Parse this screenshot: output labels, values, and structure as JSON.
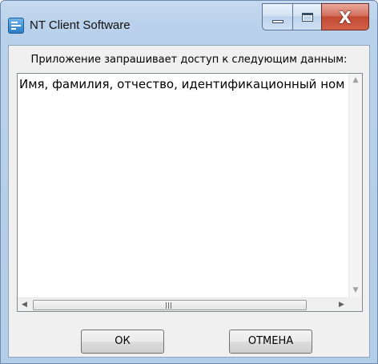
{
  "window": {
    "title": "NT Client Software",
    "caption": {
      "close_glyph": "X"
    }
  },
  "dialog": {
    "prompt": "Приложение запрашивает доступ к следующим данным:",
    "list_items": [
      "Имя, фамилия, отчество, идентификационный ном"
    ],
    "hscroll_grip": "III"
  },
  "buttons": {
    "ok_label": "ОК",
    "cancel_label": "ОТМЕНА"
  },
  "icons": {
    "app": "app-window-icon",
    "minimize": "minimize-icon",
    "maximize": "maximize-icon",
    "close": "close-icon",
    "scroll_up": "scroll-up-arrow-icon",
    "scroll_down": "scroll-down-arrow-icon",
    "scroll_left": "scroll-left-arrow-icon",
    "scroll_right": "scroll-right-arrow-icon"
  },
  "colors": {
    "frame": "#b9d1ea",
    "client": "#f0f0f0",
    "close_button": "#c24a33"
  }
}
